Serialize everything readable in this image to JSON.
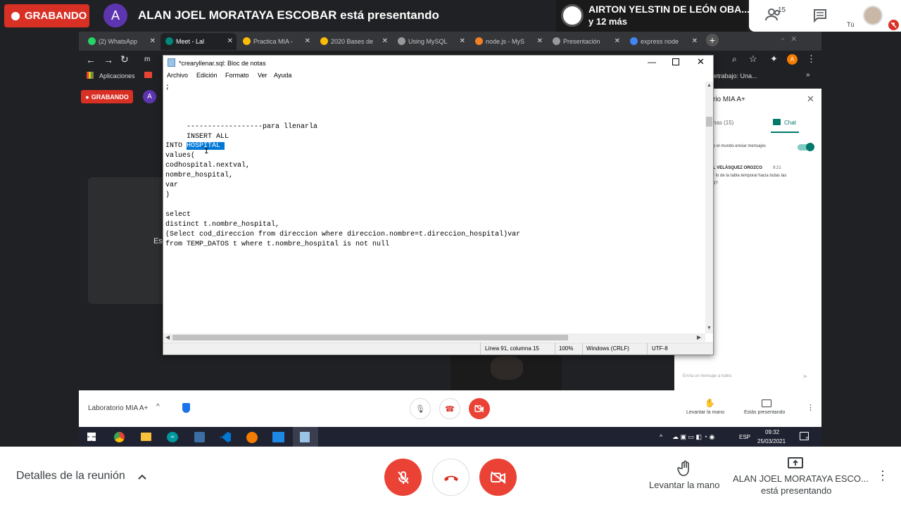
{
  "meet": {
    "recording_label": "GRABANDO",
    "presenter_avatar_letter": "A",
    "presenter_text": "ALAN JOEL MORATAYA ESCOBAR está presentando",
    "tile_name": "AIRTON YELSTIN DE LEÓN OBA...",
    "tile_more": "y 12 más",
    "participants_count": "15",
    "self_label": "Tú",
    "meeting_details": "Detalles de la reunión",
    "raise_hand": "Levantar la mano",
    "presenting_name": "ALAN JOEL MORATAYA ESCO...",
    "presenting_sub": "está presentando",
    "colors": {
      "record": "#d93025",
      "danger": "#ea4335",
      "avatar": "#5e35b1"
    }
  },
  "browser": {
    "tabs": [
      {
        "label": "(2) WhatsApp",
        "icon": "whatsapp-icon",
        "color": "#25d366"
      },
      {
        "label": "Meet - Lal",
        "icon": "meet-icon",
        "color": "#00897b"
      },
      {
        "label": "Practica MIA -",
        "icon": "drive-icon",
        "color": "#fbbc04"
      },
      {
        "label": "2020 Bases de",
        "icon": "drive-icon",
        "color": "#fbbc04"
      },
      {
        "label": "Using MySQL",
        "icon": "site-icon",
        "color": "#999999"
      },
      {
        "label": "node.js - MyS",
        "icon": "stackoverflow-icon",
        "color": "#f48024"
      },
      {
        "label": "Presentación",
        "icon": "site-icon",
        "color": "#999999"
      },
      {
        "label": "express node",
        "icon": "google-icon",
        "color": "#4285f4"
      }
    ],
    "bookmarks_apps": "Aplicaciones",
    "bookmark_right": "etrabajo: Una...",
    "url_fragment": "m"
  },
  "inner_meet": {
    "recording_label": "GRABANDO",
    "avatar_letter": "A",
    "left_partial": "Es",
    "chat_title": "rio MIA A+",
    "people_tab": "nas (15)",
    "chat_tab": "Chat",
    "allow_msgs": "o el mundo enviar mensajes",
    "msg_author": "L VELÁSQUEZ OROZCO",
    "msg_time": "9:21",
    "msg_line1": "r lo de la tabla temporal hacia todas las",
    "msg_line2": "d?",
    "chat_input": "Envía un mensaje a todos",
    "meeting_name": "Laboratorio MIA A+",
    "raise_hand": "Levantar la mano",
    "presenting": "Estás presentando"
  },
  "taskbar": {
    "lang": "ESP",
    "time": "09:32",
    "date": "25/03/2021",
    "notif_count": "5"
  },
  "notepad": {
    "title": "*crearyllenar.sql: Bloc de notas",
    "menus": [
      "Archivo",
      "Edición",
      "Formato",
      "Ver",
      "Ayuda"
    ],
    "line_before": ";",
    "line_comment": "     ------------------para llenarla",
    "line_insert": "     INSERT ALL",
    "into_prefix": "INTO ",
    "into_selected": "HOSPITAL ",
    "code_after": "values(\ncodhospital.nextval,\nnombre_hospital,\nvar\n)\n\nselect\ndistinct t.nombre_hospital,\n(Select cod_direccion from direccion where direccion.nombre=t.direccion_hospital)var\nfrom TEMP_DATOS t where t.nombre_hospital is not null",
    "status": {
      "position": "Línea 91, columna 15",
      "zoom": "100%",
      "eol": "Windows (CRLF)",
      "encoding": "UTF-8"
    }
  }
}
